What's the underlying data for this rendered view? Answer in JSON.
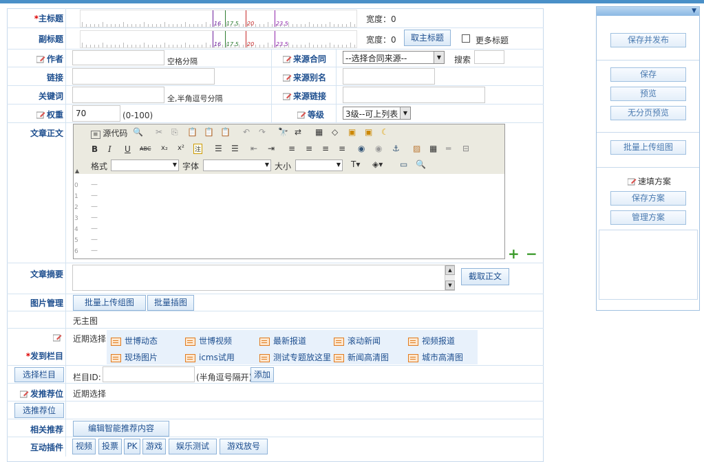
{
  "form": {
    "title_label": "主标题",
    "subtitle_label": "副标题",
    "required_mark": "*",
    "width_label_1": "宽度：0",
    "width_label_2": "宽度：0",
    "fetch_title_btn": "取主标题",
    "more_title": "更多标题",
    "ruler_marks": [
      "16",
      "17.5",
      "20",
      "23.5"
    ],
    "author_label": "作者",
    "author_hint": "空格分隔",
    "source_contract_label": "来源合同",
    "source_contract_select": "--选择合同来源--",
    "search_label": "搜索",
    "link_label": "链接",
    "source_alias_label": "来源别名",
    "keywords_label": "关键词",
    "keywords_hint": "全,半角逗号分隔",
    "source_link_label": "来源链接",
    "weight_label": "权重",
    "weight_value": "70",
    "weight_hint": "(0-100)",
    "level_label": "等级",
    "level_select": "3级--可上列表",
    "body_label": "文章正文",
    "summary_label": "文章摘要",
    "fetch_body_btn": "截取正文",
    "image_mgmt_label": "图片管理",
    "batch_upload_btn": "批量上传组图",
    "batch_insert_btn": "批量插图",
    "no_main_image": "无主图",
    "recent_choice": "近期选择",
    "publish_column_label": "发到栏目",
    "select_column_btn": "选择栏目",
    "column_id_label": "栏目ID:",
    "column_id_hint": "(半角逗号隔开)",
    "add_btn": "添加",
    "push_position_label": "发推荐位",
    "push_recent": "近期选择",
    "select_position_btn": "选推荐位",
    "related_label": "相关推荐",
    "edit_related_btn": "编辑智能推荐内容",
    "plugins_label": "互动插件",
    "plugins": [
      "视频",
      "投票",
      "PK",
      "游戏",
      "娱乐测试",
      "游戏放号"
    ],
    "categories": [
      "世博动态",
      "世博视频",
      "最新报道",
      "滚动新闻",
      "视频报道",
      "现场图片",
      "icms试用",
      "测试专题放这里",
      "新闻高清图",
      "城市高清图"
    ]
  },
  "editor": {
    "source_btn": "源代码",
    "format_label": "格式",
    "font_label": "字体",
    "size_label": "大小",
    "line_numbers": [
      "0",
      "1",
      "2",
      "3",
      "4",
      "5",
      "6"
    ],
    "plus": "+",
    "minus": "−"
  },
  "sidebar": {
    "save_publish": "保存并发布",
    "save": "保存",
    "preview": "预览",
    "preview_nopage": "无分页预览",
    "batch_upload": "批量上传组图",
    "quick_fill": "速填方案",
    "save_scheme": "保存方案",
    "manage_scheme": "管理方案"
  },
  "colors": {
    "accent": "#1e4f8f",
    "required": "#dd0000",
    "border": "#c7d9ec"
  }
}
